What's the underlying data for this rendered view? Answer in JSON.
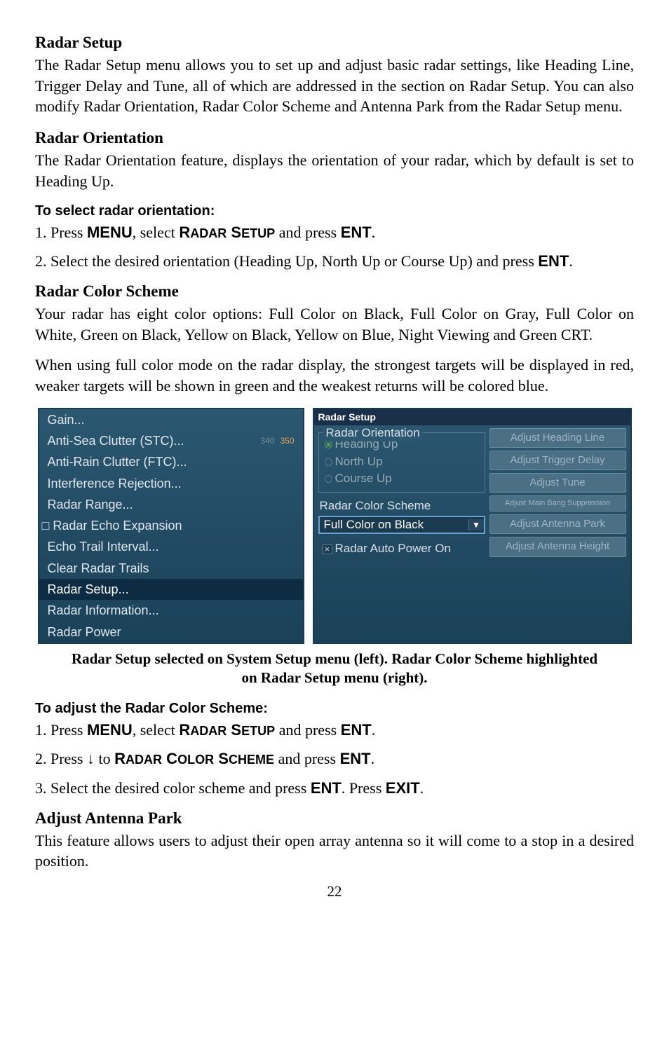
{
  "doc": {
    "radar_setup_h": "Radar Setup",
    "radar_setup_p": "The Radar Setup menu allows you to set up and adjust basic radar settings, like Heading Line, Trigger Delay and Tune, all of which are addressed in the section on Radar Setup. You can also modify Radar Orientation, Radar Color Scheme and Antenna Park from the Radar Setup menu.",
    "radar_orient_h": "Radar Orientation",
    "radar_orient_p": "The Radar Orientation feature, displays the orientation of your radar, which by default is set to Heading Up.",
    "select_orient_sub": "To select radar orientation:",
    "step1_prefix": "1. Press ",
    "menu_key": "MENU",
    "step1_mid": ", select ",
    "radar_setup_key_1": "R",
    "radar_setup_key_2": "ADAR",
    "radar_setup_key_3": " S",
    "radar_setup_key_4": "ETUP",
    "step1_suffix": " and press ",
    "ent_key": "ENT",
    "step1_end": ".",
    "step2_orient": "2. Select the desired orientation (Heading Up, North Up or Course Up) and press ",
    "rcs_h": "Radar Color Scheme",
    "rcs_p1": "Your radar has eight color options: Full Color on Black, Full Color on Gray, Full Color on White, Green on Black, Yellow on Black, Yellow on Blue, Night Viewing and Green CRT.",
    "rcs_p2": "When using full color mode on the radar display, the strongest targets will be displayed in red, weaker targets will be shown in green and the weakest returns will be colored blue.",
    "caption": "Radar Setup selected on System Setup menu (left). Radar Color Scheme highlighted on Radar Setup menu (right).",
    "adjust_rcs_sub": "To adjust the Radar Color Scheme:",
    "rcs_step2_prefix": "2. Press ",
    "down_arrow": "↓",
    "rcs_step2_to": " to ",
    "rcs_key_1": "R",
    "rcs_key_2": "ADAR",
    "rcs_key_3": " C",
    "rcs_key_4": "OLOR",
    "rcs_key_5": " S",
    "rcs_key_6": "CHEME",
    "rcs_step3": "3. Select the desired color scheme and press ",
    "rcs_step3_mid": ". Press ",
    "exit_key": "EXIT",
    "aap_h": "Adjust Antenna Park",
    "aap_p": "This feature allows users to adjust their open array antenna so it will come to a stop in a desired position.",
    "page": "22"
  },
  "leftmenu": {
    "items": [
      "Gain...",
      "Anti-Sea Clutter (STC)...",
      "Anti-Rain Clutter (FTC)...",
      "Interference Rejection...",
      "Radar Range...",
      "Radar Echo Expansion",
      "Echo Trail Interval...",
      "Clear Radar Trails",
      "Radar Setup...",
      "Radar Information...",
      "Radar Power"
    ],
    "badge340": "340",
    "badge350": "350"
  },
  "rightmenu": {
    "title": "Radar Setup",
    "orient_legend": "Radar Orientation",
    "heading_up": "Heading Up",
    "north_up": "North Up",
    "course_up": "Course Up",
    "rcs_label": "Radar Color Scheme",
    "dd_value": "Full Color on Black",
    "auto_power": "Radar Auto Power On",
    "buttons": [
      "Adjust Heading Line",
      "Adjust Trigger Delay",
      "Adjust Tune",
      "Adjust Main Bang Suppression",
      "Adjust Antenna Park",
      "Adjust Antenna Height"
    ]
  }
}
